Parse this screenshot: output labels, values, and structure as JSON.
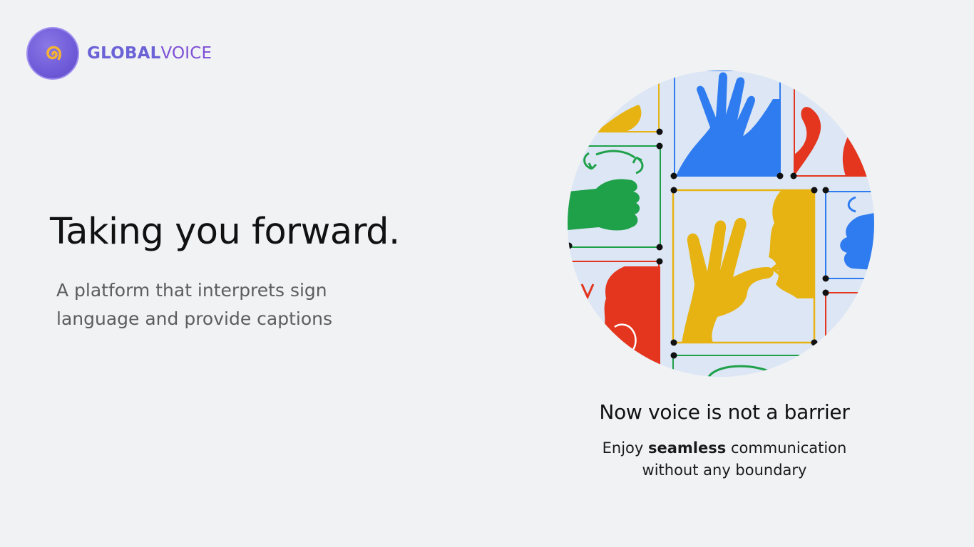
{
  "brand": {
    "name_part1": "GLOBAL",
    "name_part2": "VOICE",
    "logo_icon": "swirl-icon",
    "colors": {
      "badge": "#6f5bd8",
      "swirl": "#f5b335",
      "text_part1": "#6a62d6",
      "text_part2": "#7c4fd6"
    }
  },
  "hero": {
    "title": "Taking you forward.",
    "subtitle": "A platform that interprets sign language and provide captions"
  },
  "illustration": {
    "icon": "sign-language-hands-illustration",
    "colors": {
      "blue": "#2f7cf0",
      "red": "#e4361f",
      "yellow": "#e7b313",
      "green": "#1fa14a",
      "panel_bg": "#dce6f5"
    }
  },
  "feature": {
    "tagline": "Now voice is not a barrier",
    "desc_before": "Enjoy ",
    "desc_bold": "seamless",
    "desc_after": " communication without any boundary"
  }
}
